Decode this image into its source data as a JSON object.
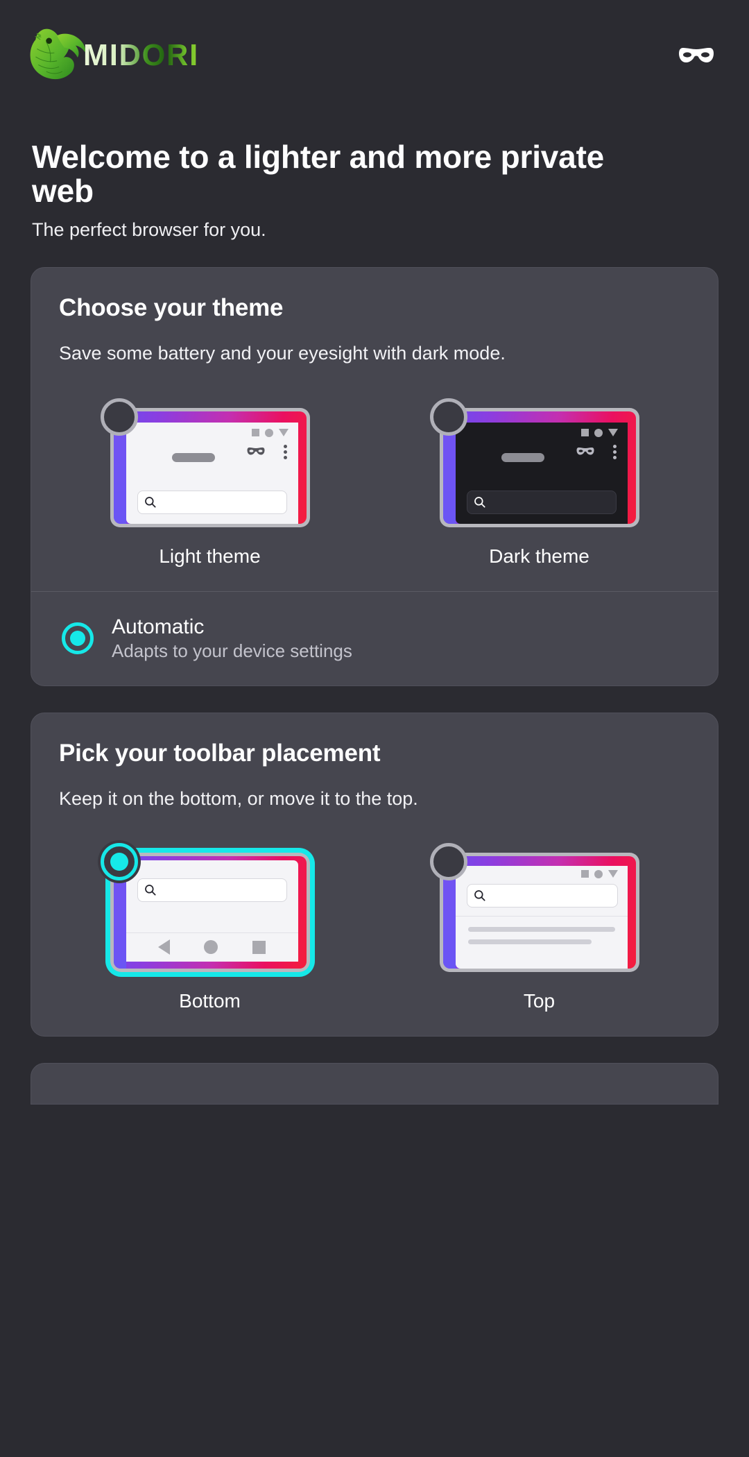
{
  "app": {
    "brand_name": "MIDORI",
    "logo_icon": "iguana-logo-icon",
    "private_mode_icon": "mask-icon"
  },
  "intro": {
    "headline": "Welcome to a lighter and more private web",
    "subhead": "The perfect browser for you."
  },
  "theme_card": {
    "title": "Choose your theme",
    "description": "Save some battery and your eyesight with dark mode.",
    "options": [
      {
        "label": "Light theme",
        "selected": false
      },
      {
        "label": "Dark theme",
        "selected": false
      }
    ],
    "automatic": {
      "label": "Automatic",
      "sublabel": "Adapts to your device settings",
      "selected": true
    }
  },
  "toolbar_card": {
    "title": "Pick your toolbar placement",
    "description": "Keep it on the bottom, or move it to the top.",
    "options": [
      {
        "label": "Bottom",
        "selected": true
      },
      {
        "label": "Top",
        "selected": false
      }
    ]
  },
  "colors": {
    "page_background": "#2b2b31",
    "card_background": "#46464f",
    "accent_cyan": "#16e8e8",
    "brand_green": "#6cb92a",
    "gradient_start": "#6a4df0",
    "gradient_end": "#f41e3c"
  },
  "icons": {
    "search": "search-icon",
    "mask": "mask-icon",
    "overflow_menu": "three-dot-menu-icon",
    "nav_back": "back-triangle-icon",
    "nav_home": "circle-icon",
    "nav_tabs": "square-icon",
    "dropdown": "triangle-down-icon"
  }
}
